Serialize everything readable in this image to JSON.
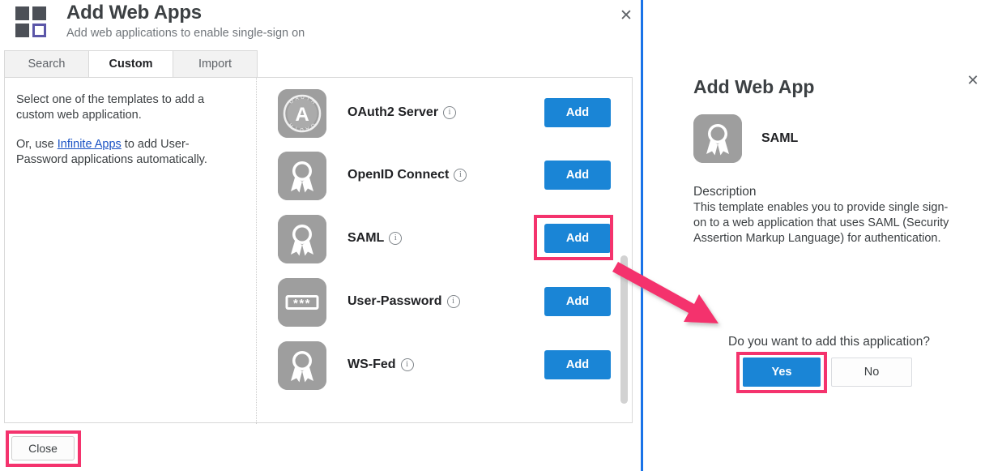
{
  "dialog": {
    "title": "Add Web Apps",
    "subtitle": "Add web applications to enable single-sign on",
    "logo_icon": "four-squares-logo",
    "close_icon": "✕",
    "tabs": [
      {
        "label": "Search",
        "active": false
      },
      {
        "label": "Custom",
        "active": true
      },
      {
        "label": "Import",
        "active": false
      }
    ],
    "intro": {
      "line1": "Select one of the templates to add a custom web application.",
      "line2_before": "Or, use ",
      "link_text": "Infinite Apps",
      "line2_after": " to add User-Password applications automatically."
    },
    "templates": [
      {
        "name": "OAuth2 Server",
        "icon": "oauth-badge-icon",
        "info_icon": "info-icon",
        "add_label": "Add",
        "highlighted": false
      },
      {
        "name": "OpenID Connect",
        "icon": "award-ribbon-icon",
        "info_icon": "info-icon",
        "add_label": "Add",
        "highlighted": false
      },
      {
        "name": "SAML",
        "icon": "award-ribbon-icon",
        "info_icon": "info-icon",
        "add_label": "Add",
        "highlighted": true
      },
      {
        "name": "User-Password",
        "icon": "password-field-icon",
        "info_icon": "info-icon",
        "add_label": "Add",
        "highlighted": false
      },
      {
        "name": "WS-Fed",
        "icon": "award-ribbon-icon",
        "info_icon": "info-icon",
        "add_label": "Add",
        "highlighted": false
      }
    ],
    "close_button": "Close"
  },
  "right_panel": {
    "title": "Add Web App",
    "close_icon": "✕",
    "app_icon": "award-ribbon-icon",
    "app_name": "SAML",
    "description_heading": "Description",
    "description_text": "This template enables you to provide single sign-on to a web application that uses SAML (Security Assertion Markup Language) for authentication.",
    "confirm_question": "Do you want to add this application?",
    "yes_label": "Yes",
    "no_label": "No"
  },
  "annotations": {
    "arrow": "pink-arrow-from-saml-add-to-confirm",
    "highlight_color": "#f4336d"
  },
  "colors": {
    "primary_blue": "#1a85d6",
    "divider_blue": "#1a73e8",
    "highlight_pink": "#f4336d",
    "icon_gray": "#9e9e9e",
    "text_dark": "#3c4043",
    "text_muted": "#70757a",
    "link_blue": "#1a52c4"
  }
}
